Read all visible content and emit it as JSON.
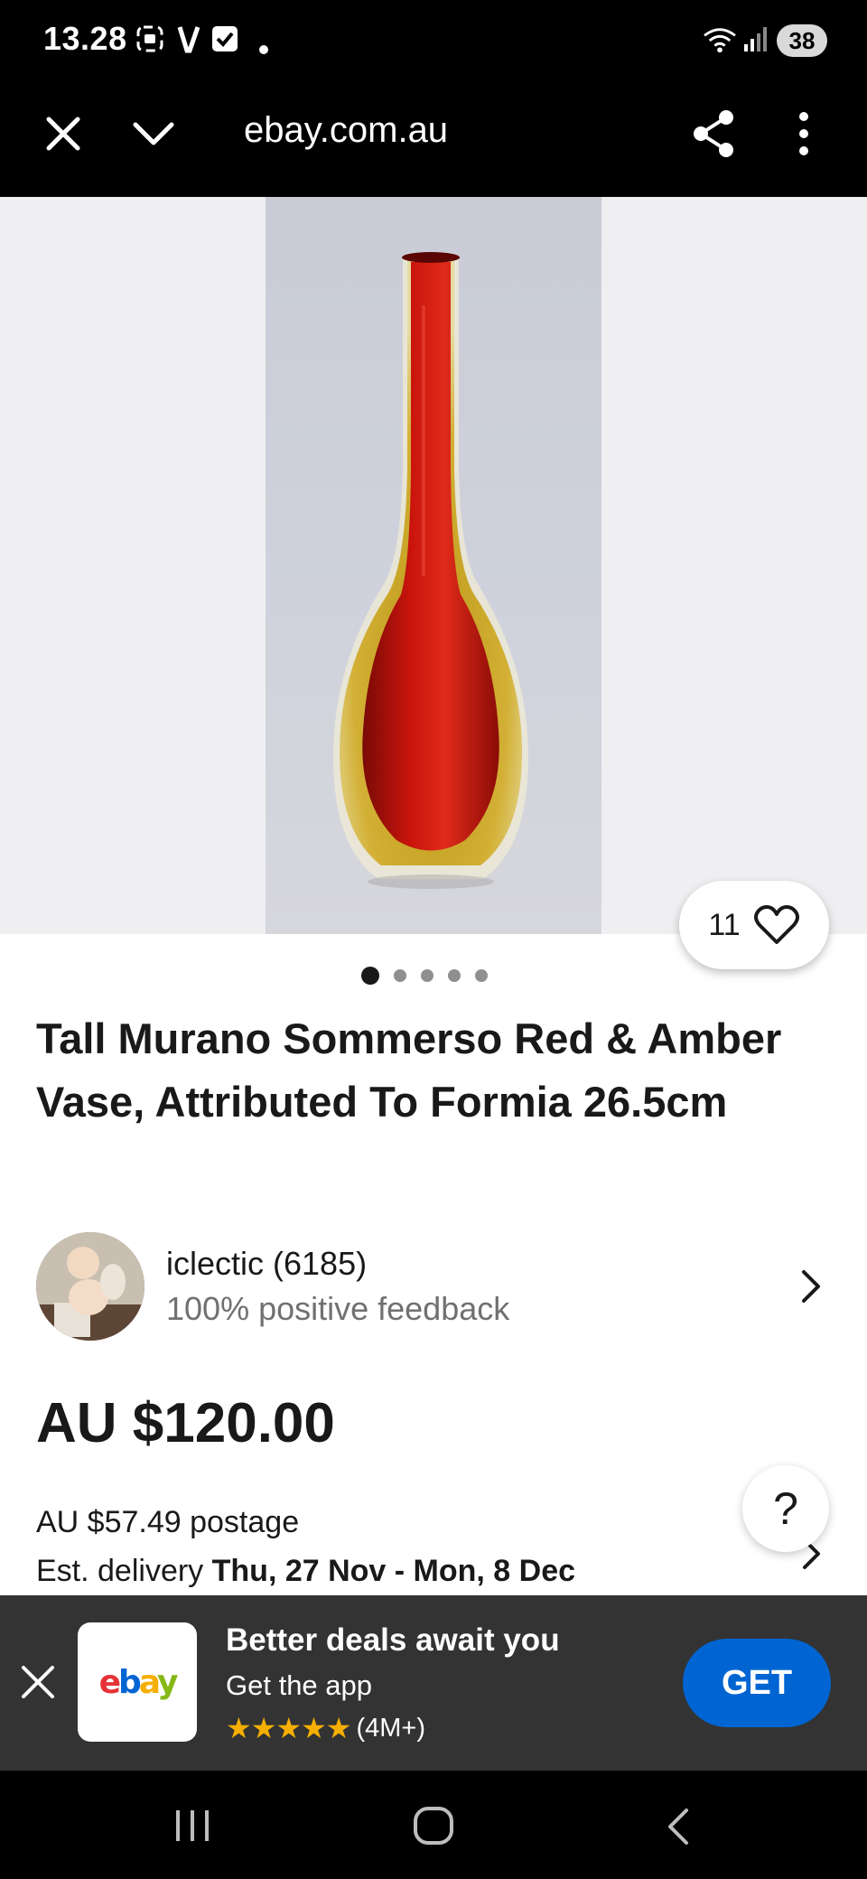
{
  "status_bar": {
    "time": "13.28",
    "battery": "38"
  },
  "browser": {
    "url": "ebay.com.au"
  },
  "gallery": {
    "image_count": 5,
    "active_index": 0,
    "watchers": "11"
  },
  "listing": {
    "title": "Tall Murano Sommerso Red & Amber Vase, Attributed To Formia 26.5cm",
    "price": "AU $120.00",
    "postage": "AU $57.49 postage",
    "delivery_label": "Est. delivery",
    "delivery_dates": "Thu, 27 Nov - Mon, 8 Dec"
  },
  "seller": {
    "name": "iclectic (6185)",
    "feedback": "100% positive feedback"
  },
  "help": {
    "label": "?"
  },
  "app_banner": {
    "title": "Better deals await you",
    "subtitle": "Get the app",
    "stars": "★★★★★",
    "rating_count": "(4M+)",
    "button_label": "GET",
    "logo_text": {
      "e": "e",
      "b": "b",
      "a": "a",
      "y": "y"
    }
  },
  "colors": {
    "accent_blue": "#0064d2",
    "star_yellow": "#f5af02",
    "banner_bg": "#333333",
    "vase_red": "#c8140c",
    "vase_amber": "#c9a020"
  }
}
